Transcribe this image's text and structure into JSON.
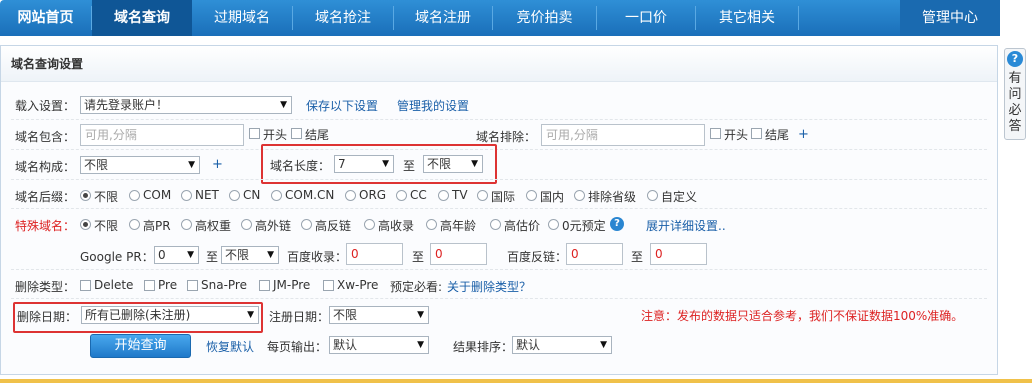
{
  "nav": {
    "items": [
      "网站首页",
      "域名查询",
      "过期域名",
      "域名抢注",
      "域名注册",
      "竞价拍卖",
      "一口价",
      "其它相关",
      "管理中心"
    ]
  },
  "help": {
    "text": "有问必答",
    "icon": "question-bubble-icon"
  },
  "panel": {
    "title": "域名查询设置",
    "load": {
      "label": "载入设置：",
      "select": "请先登录账户！",
      "save_link": "保存以下设置",
      "manage_link": "管理我的设置"
    },
    "include": {
      "label": "域名包含：",
      "placeholder": "可用,分隔",
      "start": "开头",
      "end": "结尾"
    },
    "exclude": {
      "label": "域名排除：",
      "placeholder": "可用,分隔",
      "start": "开头",
      "end": "结尾",
      "plus": "+"
    },
    "composition": {
      "label": "域名构成：",
      "select": "不限",
      "plus": "+"
    },
    "length": {
      "label": "域名长度：",
      "min": "7",
      "to": "至",
      "max": "不限"
    },
    "suffix": {
      "label": "域名后缀：",
      "options": [
        "不限",
        "COM",
        "NET",
        "CN",
        "COM.CN",
        "ORG",
        "CC",
        "TV",
        "国际",
        "国内",
        "排除省级",
        "自定义"
      ]
    },
    "special": {
      "label": "特殊域名：",
      "options": [
        "不限",
        "高PR",
        "高权重",
        "高外链",
        "高反链",
        "高收录",
        "高年龄",
        "高估价",
        "0元预定"
      ],
      "expand_link": "展开详细设置.."
    },
    "metrics": {
      "pr_label": "Google PR：",
      "pr_min": "0",
      "pr_to": "至",
      "pr_max": "不限",
      "baidu_index_label": "百度收录：",
      "baidu_index_min": "0",
      "baidu_index_to": "至",
      "baidu_index_max": "0",
      "baidu_back_label": "百度反链：",
      "baidu_back_min": "0",
      "baidu_back_to": "至",
      "baidu_back_max": "0"
    },
    "delete_type": {
      "label": "删除类型：",
      "options": [
        "Delete",
        "Pre",
        "Sna-Pre",
        "JM-Pre",
        "Xw-Pre"
      ],
      "note": "预定必看:",
      "link": "关于删除类型？"
    },
    "delete_date": {
      "label": "删除日期：",
      "select": "所有已删除(未注册)"
    },
    "reg_date": {
      "label": "注册日期：",
      "select": "不限"
    },
    "notice": "注意：发布的数据只适合参考，我们不保证数据100%准确。",
    "actions": {
      "search": "开始查询",
      "reset": "恢复默认",
      "per_page_label": "每页输出：",
      "per_page": "默认",
      "sort_label": "结果排序：",
      "sort": "默认"
    }
  },
  "colors": {
    "nav_bg": "#1a6fb9",
    "nav_active": "#0f5696",
    "highlight": "#d33",
    "link": "#1a5fa8",
    "warning": "#d22"
  }
}
